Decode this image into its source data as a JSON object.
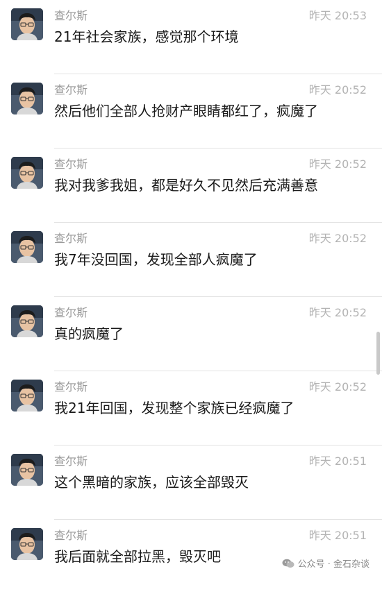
{
  "chat": {
    "messages": [
      {
        "sender": "查尔斯",
        "time": "昨天 20:53",
        "text": "21年社会家族，感觉那个环境"
      },
      {
        "sender": "查尔斯",
        "time": "昨天 20:52",
        "text": "然后他们全部人抢财产眼睛都红了，疯魔了"
      },
      {
        "sender": "查尔斯",
        "time": "昨天 20:52",
        "text": "我对我爹我姐，都是好久不见然后充满善意"
      },
      {
        "sender": "查尔斯",
        "time": "昨天 20:52",
        "text": "我7年没回国，发现全部人疯魔了"
      },
      {
        "sender": "查尔斯",
        "time": "昨天 20:52",
        "text": "真的疯魔了"
      },
      {
        "sender": "查尔斯",
        "time": "昨天 20:52",
        "text": "我21年回国，发现整个家族已经疯魔了"
      },
      {
        "sender": "查尔斯",
        "time": "昨天 20:51",
        "text": "这个黑暗的家族，应该全部毁灭"
      },
      {
        "sender": "查尔斯",
        "time": "昨天 20:51",
        "text": "我后面就全部拉黑，毁灭吧"
      }
    ]
  },
  "watermark": {
    "text": "公众号 · 金石杂谈",
    "icon": "wechat-icon"
  },
  "colors": {
    "sender": "#999999",
    "timestamp": "#b3b3b3",
    "message": "#1a1a1a",
    "divider": "#e3e3e3"
  }
}
